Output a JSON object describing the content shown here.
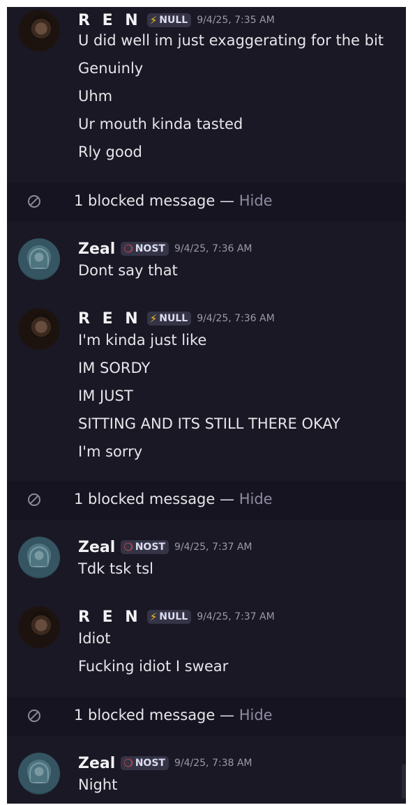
{
  "messages": [
    {
      "author": "R E N",
      "tag_icon": "⚡",
      "tag": "NULL",
      "time": "9/4/25, 7:35 AM",
      "lines": [
        "U did well im just exaggerating for the bit",
        "Genuinly",
        "Uhm",
        "Ur mouth kinda tasted",
        "Rly good"
      ]
    },
    {
      "author": "Zeal",
      "tag_icon": "❍",
      "tag": "NOST",
      "time": "9/4/25, 7:36 AM",
      "lines": [
        "Dont say that"
      ]
    },
    {
      "author": "R E N",
      "tag_icon": "⚡",
      "tag": "NULL",
      "time": "9/4/25, 7:36 AM",
      "lines": [
        "I'm kinda just like",
        "IM SORDY",
        "IM JUST",
        "SITTING AND ITS STILL THERE OKAY",
        "I'm sorry"
      ]
    },
    {
      "author": "Zeal",
      "tag_icon": "❍",
      "tag": "NOST",
      "time": "9/4/25, 7:37 AM",
      "lines": [
        "Tdk tsk tsl"
      ]
    },
    {
      "author": "R E N",
      "tag_icon": "⚡",
      "tag": "NULL",
      "time": "9/4/25, 7:37 AM",
      "lines": [
        "Idiot",
        "Fucking idiot I swear"
      ]
    },
    {
      "author": "Zeal",
      "tag_icon": "❍",
      "tag": "NOST",
      "time": "9/4/25, 7:38 AM",
      "lines": [
        "Night"
      ]
    }
  ],
  "blocked": {
    "text": "1 blocked message —",
    "hide": "Hide"
  },
  "colors": {
    "background": "#1a1825",
    "blocked_bg": "#161421",
    "null_icon": "#f5c518",
    "nost_icon": "#f04747"
  },
  "icons": {
    "blocked": "block-icon",
    "null_tag": "lightning-icon",
    "nost_tag": "ring-icon"
  }
}
